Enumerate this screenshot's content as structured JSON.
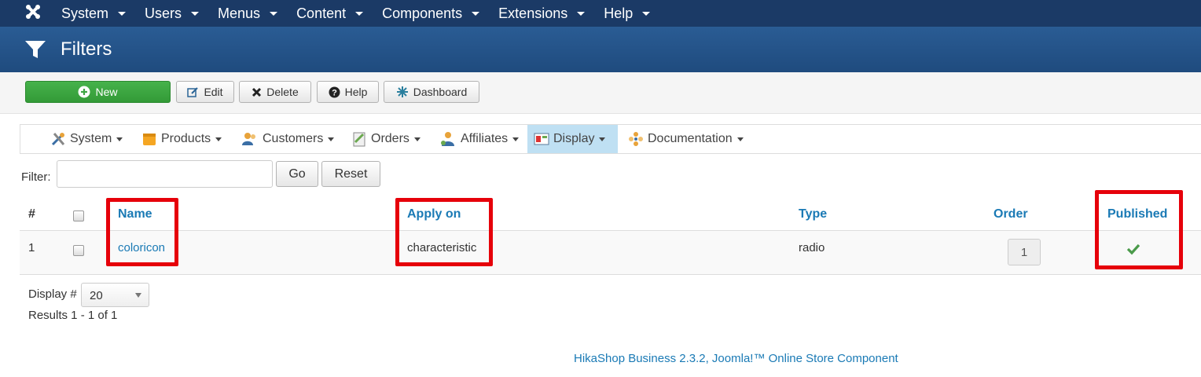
{
  "topnav": {
    "items": [
      {
        "label": "System"
      },
      {
        "label": "Users"
      },
      {
        "label": "Menus"
      },
      {
        "label": "Content"
      },
      {
        "label": "Components"
      },
      {
        "label": "Extensions"
      },
      {
        "label": "Help"
      }
    ]
  },
  "page": {
    "title": "Filters"
  },
  "toolbar": {
    "new_label": "New",
    "edit_label": "Edit",
    "delete_label": "Delete",
    "help_label": "Help",
    "dashboard_label": "Dashboard"
  },
  "hikamenu": {
    "items": [
      {
        "label": "System",
        "icon": "tools-icon"
      },
      {
        "label": "Products",
        "icon": "box-icon"
      },
      {
        "label": "Customers",
        "icon": "users-icon"
      },
      {
        "label": "Orders",
        "icon": "clipboard-icon"
      },
      {
        "label": "Affiliates",
        "icon": "affiliates-icon"
      },
      {
        "label": "Display",
        "icon": "display-icon",
        "active": true
      },
      {
        "label": "Documentation",
        "icon": "flower-icon"
      }
    ]
  },
  "filter": {
    "label": "Filter:",
    "value": "",
    "go_label": "Go",
    "reset_label": "Reset"
  },
  "table": {
    "headers": {
      "num": "#",
      "name": "Name",
      "apply_on": "Apply on",
      "type": "Type",
      "order": "Order",
      "published": "Published"
    },
    "rows": [
      {
        "num": "1",
        "name": "coloricon",
        "apply_on": "characteristic",
        "type": "radio",
        "order": "1",
        "published": true
      }
    ]
  },
  "pagination": {
    "display_label": "Display #",
    "display_value": "20",
    "results": "Results 1 - 1 of 1"
  },
  "footer": {
    "credit": "HikaShop Business 2.3.2, Joomla!™ Online Store Component"
  },
  "colors": {
    "topnav": "#1b3a66",
    "titlebar": "#1f4b7e",
    "link": "#1a7ab5",
    "highlight": "#e6000a",
    "new_button": "#3ea643"
  }
}
